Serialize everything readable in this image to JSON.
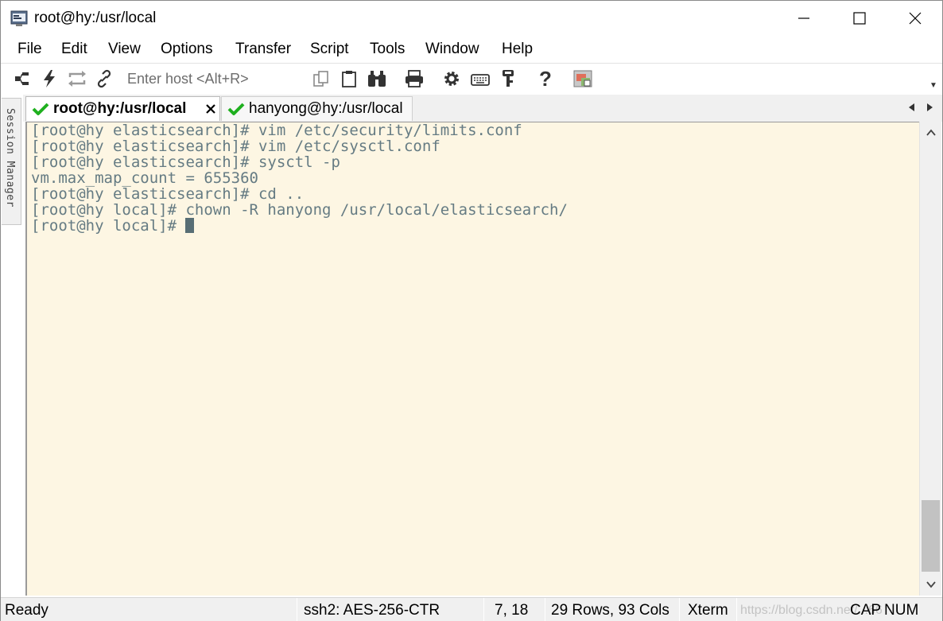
{
  "window": {
    "title": "root@hy:/usr/local"
  },
  "menu": [
    "File",
    "Edit",
    "View",
    "Options",
    "Transfer",
    "Script",
    "Tools",
    "Window",
    "Help"
  ],
  "toolbar": {
    "host_placeholder": "Enter host <Alt+R>",
    "icons": [
      "connect-icon",
      "quick-connect-icon",
      "reconnect-icon",
      "disconnect-icon",
      "copy-icon",
      "paste-icon",
      "find-icon",
      "print-icon",
      "settings-icon",
      "keymap-icon",
      "key-icon",
      "help-icon",
      "sftp-icon"
    ]
  },
  "side_panel": {
    "label": "Session Manager"
  },
  "tabs": [
    {
      "label": "root@hy:/usr/local",
      "active": true,
      "status_icon": "check-icon"
    },
    {
      "label": "hanyong@hy:/usr/local",
      "active": false,
      "status_icon": "check-icon"
    }
  ],
  "terminal": {
    "lines": [
      "[root@hy elasticsearch]# vim /etc/security/limits.conf",
      "[root@hy elasticsearch]# vim /etc/sysctl.conf",
      "[root@hy elasticsearch]# sysctl -p",
      "vm.max_map_count = 655360",
      "[root@hy elasticsearch]# cd ..",
      "[root@hy local]# chown -R hanyong /usr/local/elasticsearch/",
      "[root@hy local]# "
    ],
    "background": "#fdf6e3",
    "foreground": "#657b83",
    "scroll_position": 0.8
  },
  "status": {
    "ready": "Ready",
    "cipher": "ssh2: AES-256-CTR",
    "cursor": "7, 18",
    "size": "29 Rows, 93 Cols",
    "emulation": "Xterm",
    "watermark": "https://blog.csdn.net/...66",
    "caps": "CAP",
    "num": "NUM"
  }
}
